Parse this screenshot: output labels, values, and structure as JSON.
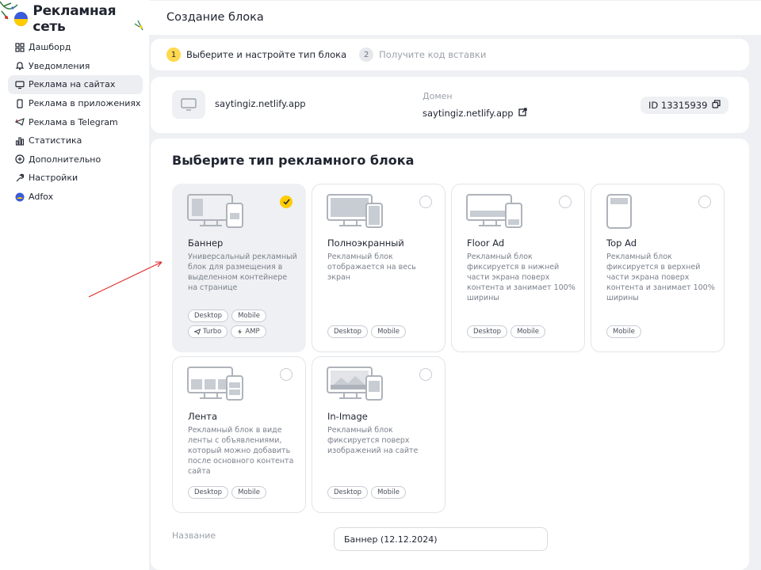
{
  "app": {
    "logo_text": "Рекламная сеть"
  },
  "sidebar": {
    "items": [
      {
        "label": "Дашборд",
        "icon": "dashboard-icon"
      },
      {
        "label": "Уведомления",
        "icon": "bell-icon"
      },
      {
        "label": "Реклама на сайтах",
        "icon": "monitor-icon",
        "active": true
      },
      {
        "label": "Реклама в приложениях",
        "icon": "phone-icon"
      },
      {
        "label": "Реклама в Telegram",
        "icon": "telegram-icon"
      },
      {
        "label": "Статистика",
        "icon": "chart-icon"
      },
      {
        "label": "Дополнительно",
        "icon": "plus-circle-icon"
      },
      {
        "label": "Настройки",
        "icon": "wrench-icon"
      },
      {
        "label": "Adfox",
        "icon": "adfox-icon"
      }
    ]
  },
  "page": {
    "title": "Создание блока"
  },
  "steps": [
    {
      "num": "1",
      "label": "Выберите и настройте тип блока",
      "active": true
    },
    {
      "num": "2",
      "label": "Получите код вставки",
      "active": false
    }
  ],
  "site": {
    "name": "saytingiz.netlify.app",
    "domain_label": "Домен",
    "domain_value": "saytingiz.netlify.app",
    "id_label": "ID 13315939"
  },
  "block_types": {
    "title": "Выберите тип рекламного блока",
    "tiles": [
      {
        "name": "Баннер",
        "desc": "Универсальный рекламный блок для размещения в выделенном контейнере на странице",
        "tags": [
          "Desktop",
          "Mobile",
          "Turbo",
          "AMP"
        ],
        "selected": true
      },
      {
        "name": "Полноэкранный",
        "desc": "Рекламный блок отображается на весь экран",
        "tags": [
          "Desktop",
          "Mobile"
        ],
        "selected": false
      },
      {
        "name": "Floor Ad",
        "desc": "Рекламный блок фиксируется в нижней части экрана поверх контента и занимает 100% ширины",
        "tags": [
          "Desktop",
          "Mobile"
        ],
        "selected": false
      },
      {
        "name": "Top Ad",
        "desc": "Рекламный блок фиксируется в верхней части экрана поверх контента и занимает 100% ширины",
        "tags": [
          "Mobile"
        ],
        "selected": false
      },
      {
        "name": "Лента",
        "desc": "Рекламный блок в виде ленты с объявлениями, который можно добавить после основного контента сайта",
        "tags": [
          "Desktop",
          "Mobile"
        ],
        "selected": false
      },
      {
        "name": "In-Image",
        "desc": "Рекламный блок фиксируется поверх изображений на сайте",
        "tags": [
          "Desktop",
          "Mobile"
        ],
        "selected": false
      }
    ]
  },
  "name_field": {
    "label": "Название",
    "value": "Баннер (12.12.2024)"
  },
  "colors": {
    "accent": "#ffcc00",
    "annotation_arrow": "#e02020",
    "background": "#eef0f3"
  }
}
